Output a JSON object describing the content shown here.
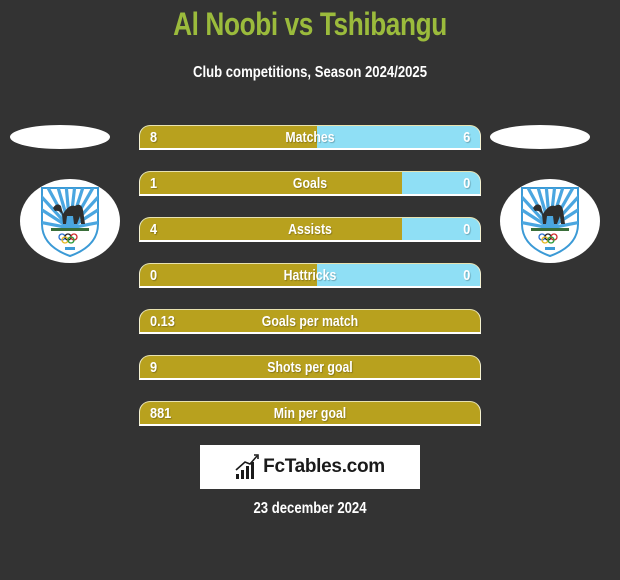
{
  "header": {
    "title": "Al Noobi vs Tshibangu",
    "subtitle": "Club competitions, Season 2024/2025"
  },
  "players": {
    "left": {
      "name": "Al Noobi",
      "crest_icon": "club-crest-camel-icon"
    },
    "right": {
      "name": "Tshibangu",
      "crest_icon": "club-crest-camel-icon"
    }
  },
  "colors": {
    "title": "#9bbb3c",
    "left_bar": "#b8a11e",
    "right_bar": "#8fdff5",
    "background": "#333333"
  },
  "stats": [
    {
      "label": "Matches",
      "left": "8",
      "right": "6",
      "left_share": 0.52
    },
    {
      "label": "Goals",
      "left": "1",
      "right": "0",
      "left_share": 0.77
    },
    {
      "label": "Assists",
      "left": "4",
      "right": "0",
      "left_share": 0.77
    },
    {
      "label": "Hattricks",
      "left": "0",
      "right": "0",
      "left_share": 0.52
    },
    {
      "label": "Goals per match",
      "left": "0.13",
      "right": null,
      "left_share": 1
    },
    {
      "label": "Shots per goal",
      "left": "9",
      "right": null,
      "left_share": 1
    },
    {
      "label": "Min per goal",
      "left": "881",
      "right": null,
      "left_share": 1
    }
  ],
  "footer": {
    "brand": "FcTables.com",
    "brand_icon": "bar-chart-trend-icon",
    "date": "23 december 2024"
  }
}
